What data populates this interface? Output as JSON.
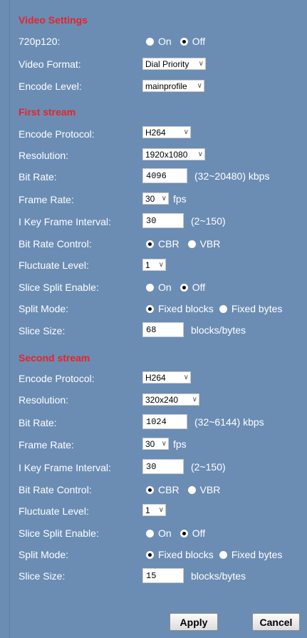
{
  "video_settings": {
    "title": "Video Settings",
    "p720p120": {
      "label": "720p120:",
      "on": "On",
      "off": "Off",
      "selected": "off"
    },
    "video_format": {
      "label": "Video Format:",
      "value": "Dial Priority"
    },
    "encode_level": {
      "label": "Encode Level:",
      "value": "mainprofile"
    }
  },
  "first_stream": {
    "title": "First stream",
    "encode_protocol": {
      "label": "Encode Protocol:",
      "value": "H264"
    },
    "resolution": {
      "label": "Resolution:",
      "value": "1920x1080"
    },
    "bit_rate": {
      "label": "Bit Rate:",
      "value": "4096",
      "suffix": "(32~20480) kbps"
    },
    "frame_rate": {
      "label": "Frame Rate:",
      "value": "30",
      "suffix": "fps"
    },
    "key_frame": {
      "label": "I Key Frame Interval:",
      "value": "30",
      "suffix": "(2~150)"
    },
    "bit_rate_control": {
      "label": "Bit Rate Control:",
      "cbr": "CBR",
      "vbr": "VBR",
      "selected": "cbr"
    },
    "fluctuate": {
      "label": "Fluctuate Level:",
      "value": "1"
    },
    "slice_split": {
      "label": "Slice Split Enable:",
      "on": "On",
      "off": "Off",
      "selected": "off"
    },
    "split_mode": {
      "label": "Split Mode:",
      "blocks": "Fixed blocks",
      "bytes": "Fixed bytes",
      "selected": "blocks"
    },
    "slice_size": {
      "label": "Slice Size:",
      "value": "68",
      "suffix": "blocks/bytes"
    }
  },
  "second_stream": {
    "title": "Second stream",
    "encode_protocol": {
      "label": "Encode Protocol:",
      "value": "H264"
    },
    "resolution": {
      "label": "Resolution:",
      "value": "320x240"
    },
    "bit_rate": {
      "label": "Bit Rate:",
      "value": "1024",
      "suffix": "(32~6144) kbps"
    },
    "frame_rate": {
      "label": "Frame Rate:",
      "value": "30",
      "suffix": "fps"
    },
    "key_frame": {
      "label": "I Key Frame Interval:",
      "value": "30",
      "suffix": "(2~150)"
    },
    "bit_rate_control": {
      "label": "Bit Rate Control:",
      "cbr": "CBR",
      "vbr": "VBR",
      "selected": "cbr"
    },
    "fluctuate": {
      "label": "Fluctuate Level:",
      "value": "1"
    },
    "slice_split": {
      "label": "Slice Split Enable:",
      "on": "On",
      "off": "Off",
      "selected": "off"
    },
    "split_mode": {
      "label": "Split Mode:",
      "blocks": "Fixed blocks",
      "bytes": "Fixed bytes",
      "selected": "blocks"
    },
    "slice_size": {
      "label": "Slice Size:",
      "value": "15",
      "suffix": "blocks/bytes"
    }
  },
  "buttons": {
    "apply": "Apply",
    "cancel": "Cancel"
  },
  "colors": {
    "background": "#6b8db4",
    "section_title": "#e8232a",
    "text": "#ffffff"
  }
}
